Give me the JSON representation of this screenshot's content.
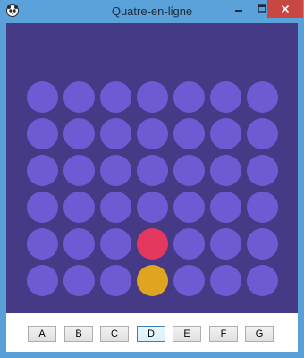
{
  "window": {
    "title": "Quatre-en-ligne",
    "app_icon": "panda-icon",
    "controls": [
      "minimize-icon",
      "maximize-icon",
      "close-icon"
    ]
  },
  "colors": {
    "board_bg": "#453a85",
    "empty": "#6e5bd4",
    "red": "#e3375f",
    "yellow": "#dfa520",
    "close_button": "#c74842"
  },
  "board": {
    "rows": 6,
    "cols": 7,
    "cells": [
      [
        "empty",
        "empty",
        "empty",
        "empty",
        "empty",
        "empty",
        "empty"
      ],
      [
        "empty",
        "empty",
        "empty",
        "empty",
        "empty",
        "empty",
        "empty"
      ],
      [
        "empty",
        "empty",
        "empty",
        "empty",
        "empty",
        "empty",
        "empty"
      ],
      [
        "empty",
        "empty",
        "empty",
        "empty",
        "empty",
        "empty",
        "empty"
      ],
      [
        "empty",
        "empty",
        "empty",
        "red",
        "empty",
        "empty",
        "empty"
      ],
      [
        "empty",
        "empty",
        "empty",
        "yellow",
        "empty",
        "empty",
        "empty"
      ]
    ]
  },
  "columns": {
    "labels": [
      "A",
      "B",
      "C",
      "D",
      "E",
      "F",
      "G"
    ],
    "focused": "D"
  }
}
